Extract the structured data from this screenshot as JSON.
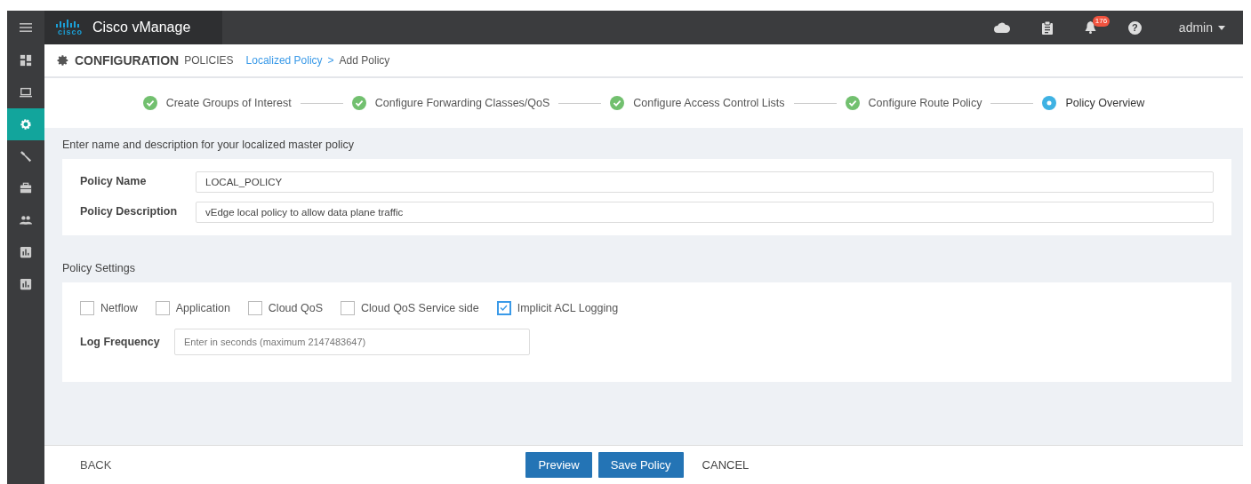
{
  "header": {
    "product": "Cisco vManage",
    "logo_text": "cisco",
    "notification_count": "176",
    "help": "?",
    "user": "admin"
  },
  "sidebar": {
    "items": [
      {
        "kind": "dashboard",
        "selected": false
      },
      {
        "kind": "monitor",
        "selected": false
      },
      {
        "kind": "configuration",
        "selected": true
      },
      {
        "kind": "tools",
        "selected": false
      },
      {
        "kind": "maintenance",
        "selected": false
      },
      {
        "kind": "administration",
        "selected": false
      },
      {
        "kind": "analytics",
        "selected": false
      },
      {
        "kind": "analytics",
        "selected": false
      }
    ]
  },
  "breadcrumb": {
    "section": "CONFIGURATION",
    "subsection": "POLICIES",
    "link": "Localized Policy",
    "separator": ">",
    "current": "Add Policy"
  },
  "steps": [
    {
      "label": "Create Groups of Interest",
      "completed": true
    },
    {
      "label": "Configure Forwarding Classes/QoS",
      "completed": true
    },
    {
      "label": "Configure Access Control Lists",
      "completed": true
    },
    {
      "label": "Configure Route Policy",
      "completed": true
    },
    {
      "label": "Policy Overview",
      "completed": false
    }
  ],
  "name_section": {
    "heading": "Enter name and description for your localized master policy",
    "fields": [
      {
        "label": "Policy Name",
        "value": "LOCAL_POLICY"
      },
      {
        "label": "Policy Description",
        "value": "vEdge local policy to allow data plane traffic"
      }
    ]
  },
  "settings": {
    "heading": "Policy Settings",
    "options": [
      {
        "label": "Netflow",
        "checked": false
      },
      {
        "label": "Application",
        "checked": false
      },
      {
        "label": "Cloud QoS",
        "checked": false
      },
      {
        "label": "Cloud QoS Service side",
        "checked": false
      },
      {
        "label": "Implicit ACL Logging",
        "checked": true
      }
    ],
    "log_frequency": {
      "label": "Log Frequency",
      "placeholder": "Enter in seconds (maximum 2147483647)"
    }
  },
  "footer": {
    "back": "BACK",
    "preview": "Preview",
    "save": "Save Policy",
    "cancel": "CANCEL"
  }
}
